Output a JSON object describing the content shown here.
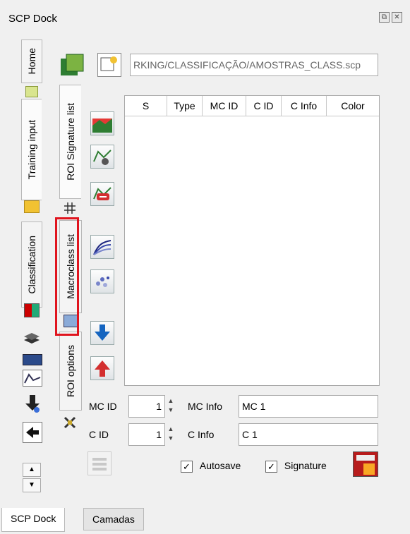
{
  "window": {
    "title": "SCP Dock",
    "float_button": "⧉",
    "close_button": "✕"
  },
  "left_tabs": [
    "Home",
    "Training input",
    "Classification"
  ],
  "inner_tabs": [
    "ROI Signature list",
    "Macroclass list",
    "ROI options"
  ],
  "path_field": {
    "value": "RKING/CLASSIFICAÇÃO/AMOSTRAS_CLASS.scp"
  },
  "table": {
    "columns": [
      "S",
      "Type",
      "MC ID",
      "C ID",
      "C Info",
      "Color"
    ]
  },
  "form": {
    "mc_id_label": "MC ID",
    "mc_id_value": "1",
    "mc_info_label": "MC Info",
    "mc_info_value": "MC 1",
    "c_id_label": "C ID",
    "c_id_value": "1",
    "c_info_label": "C Info",
    "c_info_value": "C 1",
    "autosave_label": "Autosave",
    "signature_label": "Signature",
    "check_mark": "✓"
  },
  "bottom_tabs": [
    "SCP Dock",
    "Camadas"
  ],
  "highlight_color": "#e0141e"
}
